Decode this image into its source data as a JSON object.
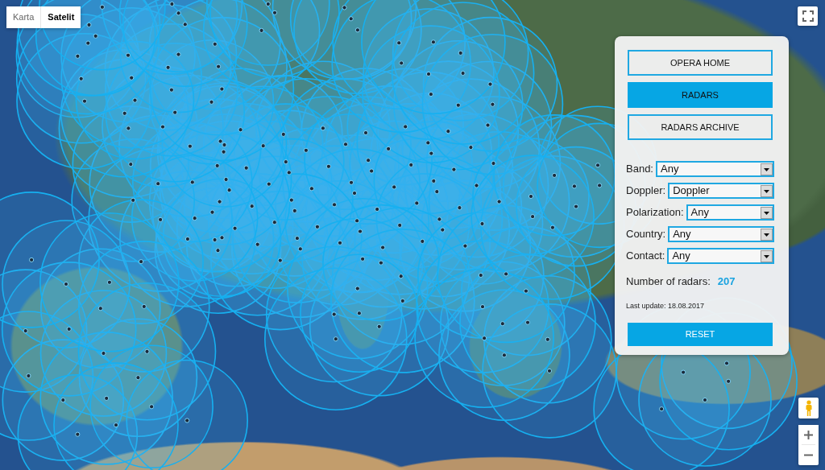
{
  "map_type": [
    {
      "label": "Karta",
      "selected": false
    },
    {
      "label": "Satelit",
      "selected": true
    }
  ],
  "panel": {
    "nav_buttons": [
      {
        "label": "OPERA HOME",
        "selected": false
      },
      {
        "label": "RADARS",
        "selected": true
      },
      {
        "label": "RADARS ARCHIVE",
        "selected": false
      }
    ],
    "filters": [
      {
        "label": "Band:",
        "value": "Any"
      },
      {
        "label": "Doppler:",
        "value": "Doppler"
      },
      {
        "label": "Polarization:",
        "value": "Any"
      },
      {
        "label": "Country:",
        "value": "Any"
      },
      {
        "label": "Contact:",
        "value": "Any"
      }
    ],
    "radar_count": {
      "label": "Number of radars:",
      "value": "207"
    },
    "last_update": "Last update: 18.08.2017",
    "reset_button": "RESET"
  }
}
